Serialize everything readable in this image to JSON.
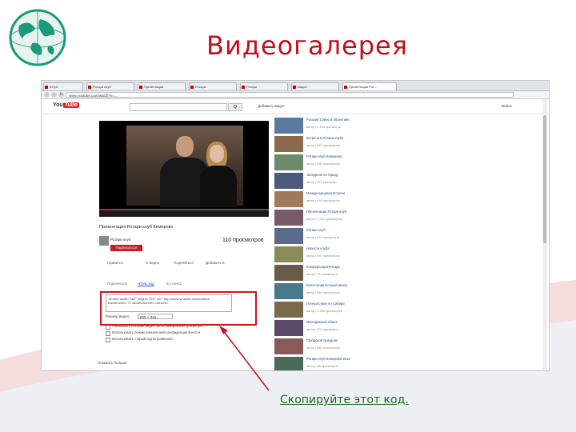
{
  "slide": {
    "title": "Видеогалерея",
    "caption": "Скопируйте этот код.",
    "accent_color": "#c0101a",
    "caption_color": "#1e6b1e",
    "highlight_color": "#d0141c",
    "logo_icon": "globe-icon"
  },
  "browser": {
    "tabs": [
      {
        "label": "Ютуб",
        "active": false
      },
      {
        "label": "Ротари клуб",
        "active": false
      },
      {
        "label": "Презентация",
        "active": false
      },
      {
        "label": "Ротари",
        "active": false
      },
      {
        "label": "Ротари",
        "active": false
      },
      {
        "label": "Видео",
        "active": false
      },
      {
        "label": "Презентация Рот…",
        "active": true
      }
    ],
    "url": "www.youtube.com/watch?v=…"
  },
  "youtube": {
    "logo_you": "You",
    "logo_tube": "Tube",
    "search_button": "Q",
    "header_links": [
      "Добавить видео",
      "Войти"
    ],
    "video": {
      "progress": 0.08,
      "title": "Презентация Ротари клуб Кемерово",
      "channel": "Ротари клуб",
      "subscribe": "Подписаться",
      "views": "110 просмотров"
    },
    "actions": [
      "Нравится",
      "О видео",
      "Поделиться",
      "Добавить в"
    ],
    "share_tabs": [
      "Поделиться",
      "HTML-код",
      "Эл. почта"
    ],
    "share_active": "HTML-код",
    "embed_code": "<iframe width=\"560\" height=\"315\" src=\"http://www.youtube.com/embed/…\" frameborder=\"0\" allowfullscreen></iframe>",
    "size_label": "Размер видео:",
    "size_value": "560 × 315",
    "options": [
      "Показывать похожие видео после завершения просмотра",
      "Использовать режим повышенной конфиденциальности",
      "Использовать старый код встраивания"
    ],
    "more": "Показать больше",
    "related": [
      {
        "title": "Русский Север в объективе",
        "meta": "автор • 1 234 просмотра"
      },
      {
        "title": "Встреча в Ротари клубе",
        "meta": "автор • 567 просмотров"
      },
      {
        "title": "Ротари клуб Кемерово",
        "meta": "автор • 890 просмотров"
      },
      {
        "title": "Экскурсия по городу",
        "meta": "автор • 321 просмотр"
      },
      {
        "title": "Международная встреча",
        "meta": "автор • 456 просмотров"
      },
      {
        "title": "Презентация Ротари клуб",
        "meta": "автор • 2 010 просмотров"
      },
      {
        "title": "Ротари клуб",
        "meta": "автор • 112 просмотров"
      },
      {
        "title": "Новости клуба",
        "meta": "автор • 980 просмотров"
      },
      {
        "title": "Конференция Ротари",
        "meta": "автор • 76 просмотров"
      },
      {
        "title": "Благотворительный вечер",
        "meta": "автор • 340 просмотров"
      },
      {
        "title": "Путешествие по Сибири",
        "meta": "автор • 1 450 просмотров"
      },
      {
        "title": "Молодёжный обмен",
        "meta": "автор • 203 просмотра"
      },
      {
        "title": "Городской праздник",
        "meta": "автор • 660 просмотров"
      },
      {
        "title": "Ротари клуб Кемерово 2012",
        "meta": "автор • 98 просмотров"
      }
    ]
  }
}
